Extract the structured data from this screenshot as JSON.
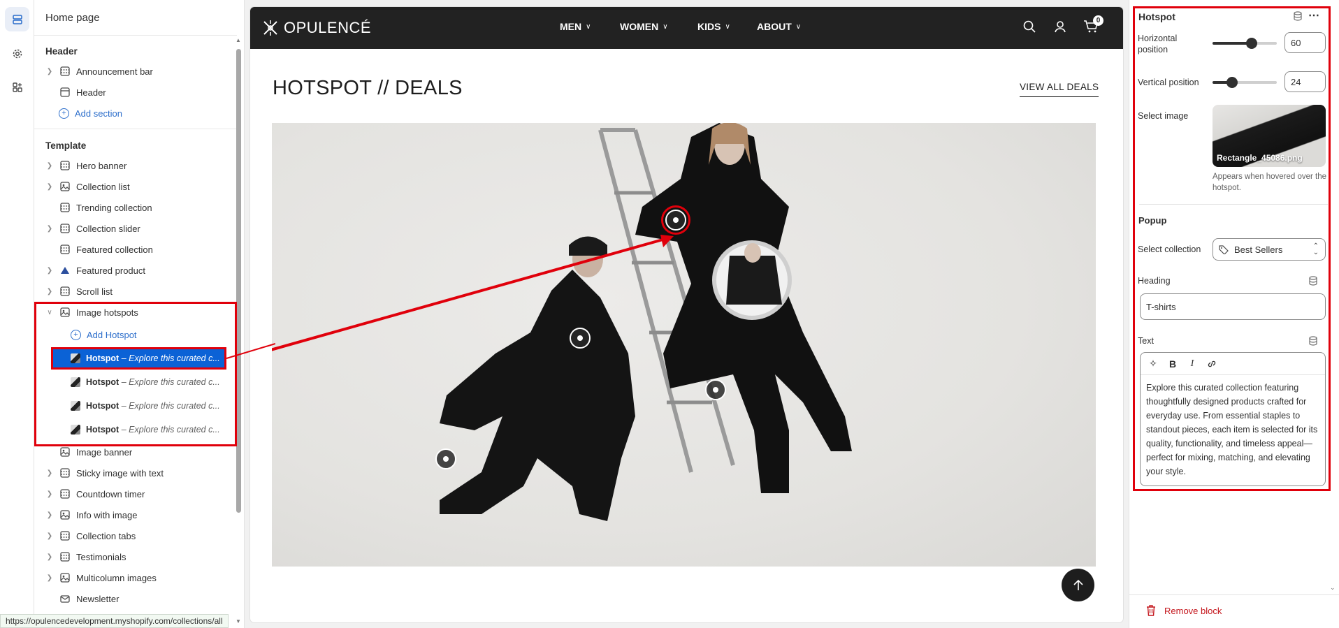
{
  "sidebar": {
    "title": "Home page",
    "header_group": "Header",
    "header_items": [
      "Announcement bar",
      "Header"
    ],
    "add_section": "Add section",
    "template_group": "Template",
    "template_items": [
      {
        "label": "Hero banner",
        "expandable": true,
        "icon": "section-icon"
      },
      {
        "label": "Collection list",
        "expandable": true,
        "icon": "image-icon"
      },
      {
        "label": "Trending collection",
        "expandable": false,
        "icon": "section-icon"
      },
      {
        "label": "Collection slider",
        "expandable": true,
        "icon": "section-icon"
      },
      {
        "label": "Featured collection",
        "expandable": false,
        "icon": "section-icon"
      },
      {
        "label": "Featured product",
        "expandable": true,
        "icon": "product-icon"
      },
      {
        "label": "Scroll list",
        "expandable": true,
        "icon": "section-icon"
      },
      {
        "label": "Image hotspots",
        "expandable": true,
        "icon": "image-icon"
      }
    ],
    "add_hotspot": "Add Hotspot",
    "hotspots": [
      {
        "name": "Hotspot",
        "desc": "– Explore this curated c..."
      },
      {
        "name": "Hotspot",
        "desc": "– Explore this curated c..."
      },
      {
        "name": "Hotspot",
        "desc": "– Explore this curated c..."
      },
      {
        "name": "Hotspot",
        "desc": "– Explore this curated c..."
      }
    ],
    "after_items": [
      {
        "label": "Image banner",
        "expandable": false,
        "icon": "image-icon"
      },
      {
        "label": "Sticky image with text",
        "expandable": true,
        "icon": "section-icon"
      },
      {
        "label": "Countdown timer",
        "expandable": true,
        "icon": "section-icon"
      },
      {
        "label": "Info with image",
        "expandable": true,
        "icon": "image-icon"
      },
      {
        "label": "Collection tabs",
        "expandable": true,
        "icon": "section-icon"
      },
      {
        "label": "Testimonials",
        "expandable": true,
        "icon": "section-icon"
      },
      {
        "label": "Multicolumn images",
        "expandable": true,
        "icon": "image-icon"
      },
      {
        "label": "Newsletter",
        "expandable": false,
        "icon": "mail-icon"
      }
    ],
    "status_url": "https://opulencedevelopment.myshopify.com/collections/all"
  },
  "store": {
    "logo": "OPULENCÉ",
    "nav": [
      "MEN",
      "WOMEN",
      "KIDS",
      "ABOUT"
    ],
    "cart_count": "0",
    "section_title": "HOTSPOT // DEALS",
    "view_all": "VIEW ALL DEALS"
  },
  "settings": {
    "title": "Hotspot",
    "horizontal_label": "Horizontal position",
    "horizontal_value": "60",
    "vertical_label": "Vertical position",
    "vertical_value": "24",
    "select_image_label": "Select image",
    "image_filename": "Rectangle_45086.png",
    "image_help": "Appears when hovered over the hotspot.",
    "popup_group": "Popup",
    "select_collection_label": "Select collection",
    "collection_value": "Best Sellers",
    "heading_label": "Heading",
    "heading_value": "T-shirts",
    "text_label": "Text",
    "text_value": "Explore this curated collection featuring thoughtfully designed products crafted for everyday use. From essential staples to standout pieces, each item is selected for its quality, functionality, and timeless appeal—perfect for mixing, matching, and elevating your style.",
    "remove_block": "Remove block"
  },
  "colors": {
    "accent": "#2c6ecb",
    "selected_row": "#0b62d6",
    "annotation_red": "#e0000b",
    "store_header": "#222222",
    "danger": "#c4161c"
  }
}
